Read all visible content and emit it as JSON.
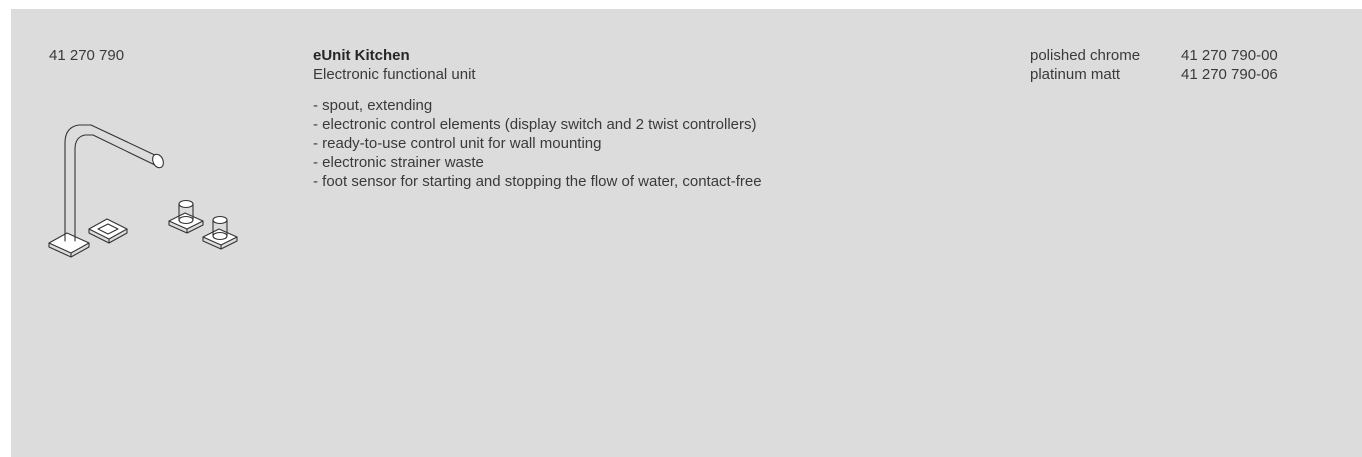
{
  "article_number": "41 270 790",
  "product": {
    "title": "eUnit Kitchen",
    "subtitle": "Electronic functional unit",
    "features": [
      "- spout, extending",
      "- electronic control elements (display switch and 2 twist controllers)",
      "- ready-to-use control unit for wall mounting",
      "- electronic strainer waste",
      "- foot sensor for starting and stopping the flow of water, contact-free"
    ]
  },
  "finishes": [
    {
      "name": "polished chrome",
      "code": "41 270 790-00"
    },
    {
      "name": "platinum matt",
      "code": "41 270 790-06"
    }
  ],
  "illustration": {
    "icon": "kitchen-faucet-line-drawing-icon"
  },
  "colors": {
    "panel_background": "#dcdcdc",
    "text": "#3a3a3a"
  }
}
